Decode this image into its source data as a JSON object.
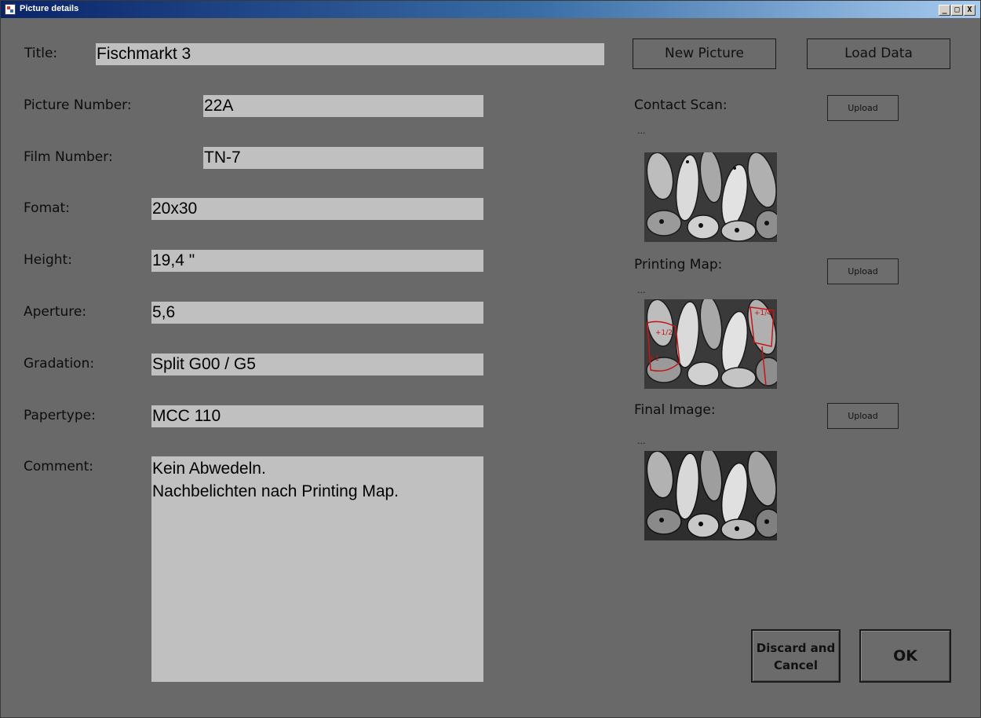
{
  "window": {
    "title": "Picture details",
    "buttons": {
      "minimize": "_",
      "maximize": "□",
      "close": "X"
    }
  },
  "form": {
    "title_label": "Title:",
    "title_value": "Fischmarkt 3",
    "picture_number_label": "Picture Number:",
    "picture_number_value": "22A",
    "film_number_label": "Film Number:",
    "film_number_value": "TN-7",
    "format_label": "Fomat:",
    "format_value": "20x30",
    "height_label": "Height:",
    "height_value": "19,4 \"",
    "aperture_label": "Aperture:",
    "aperture_value": "5,6",
    "gradation_label": "Gradation:",
    "gradation_value": "Split G00 / G5",
    "papertype_label": "Papertype:",
    "papertype_value": "MCC 110",
    "comment_label": "Comment:",
    "comment_value": "Kein Abwedeln.\nNachbelichten nach Printing Map."
  },
  "actions": {
    "new_picture": "New Picture",
    "load_data": "Load Data",
    "discard_cancel": "Discard and Cancel",
    "ok": "OK"
  },
  "images": {
    "contact_scan_label": "Contact Scan:",
    "printing_map_label": "Printing Map:",
    "final_image_label": "Final Image:",
    "upload_label": "Upload",
    "path_placeholder": "...",
    "icons": [
      "fish-photo-thumbnail",
      "fish-photo-printing-map",
      "fish-photo-final"
    ],
    "map_annotation_color": "#c81414"
  },
  "colors": {
    "background": "#696969",
    "field_bg": "#c0c0c0",
    "titlebar_start": "#0a246a",
    "titlebar_end": "#a6caf0"
  }
}
